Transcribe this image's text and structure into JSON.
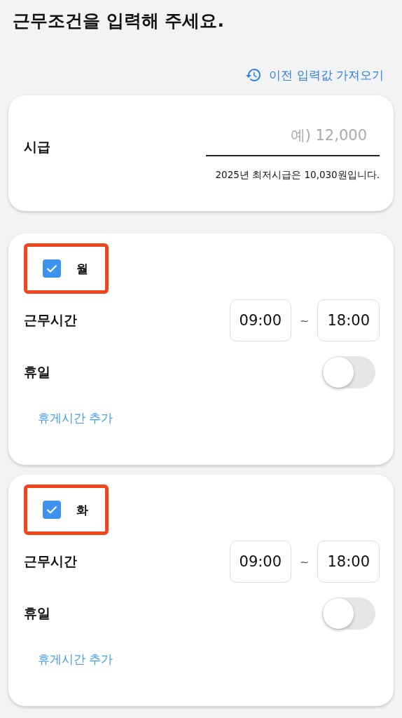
{
  "title": "근무조건을 입력해 주세요.",
  "load_previous_link": "이전 입력값 가져오기",
  "wage": {
    "label": "시급",
    "placeholder": "예) 12,000",
    "note": "2025년 최저시급은 10,030원입니다."
  },
  "days": [
    {
      "day": "월",
      "checked": true,
      "highlighted": true,
      "hours_label": "근무시간",
      "start": "09:00",
      "separator": "~",
      "end": "18:00",
      "holiday_label": "휴일",
      "holiday_on": false,
      "add_break": "휴게시간 추가"
    },
    {
      "day": "화",
      "checked": true,
      "highlighted": true,
      "hours_label": "근무시간",
      "start": "09:00",
      "separator": "~",
      "end": "18:00",
      "holiday_label": "휴일",
      "holiday_on": false,
      "add_break": "휴게시간 추가"
    }
  ]
}
